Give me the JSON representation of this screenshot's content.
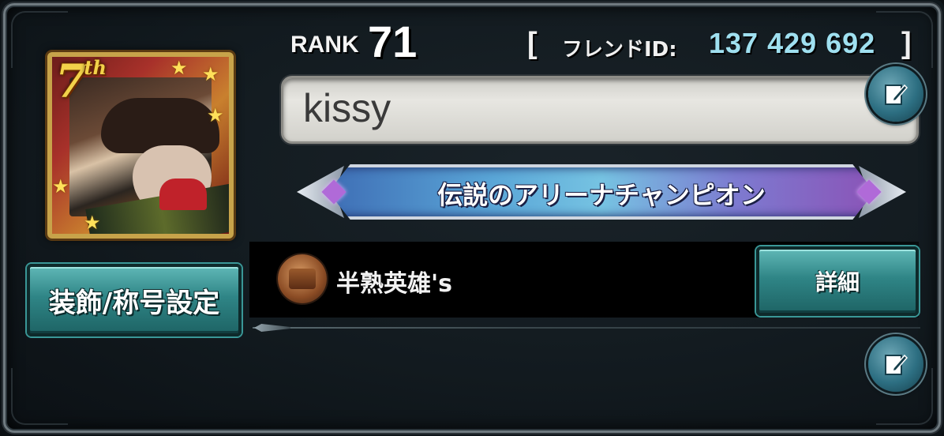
{
  "profile": {
    "rank_label": "RANK",
    "rank_value": "71",
    "friend_open": "[",
    "friend_label": "フレンドID:",
    "friend_id": "137 429 692",
    "friend_close": "]",
    "player_name": "kissy",
    "title": "伝説のアリーナチャンピオン"
  },
  "avatar": {
    "badge_number": "7",
    "badge_suffix": "th"
  },
  "buttons": {
    "equip_label": "装飾/称号設定",
    "detail_label": "詳細"
  },
  "guild": {
    "name": "半熟英雄's",
    "emblem_icon": "guild-emblem-icon"
  },
  "icons": {
    "edit_name": "edit-icon",
    "edit_comment": "edit-icon"
  },
  "colors": {
    "accent_teal": "#2f8586",
    "friend_id_color": "#9fe0f0",
    "frame_gold": "#c7a34a"
  }
}
